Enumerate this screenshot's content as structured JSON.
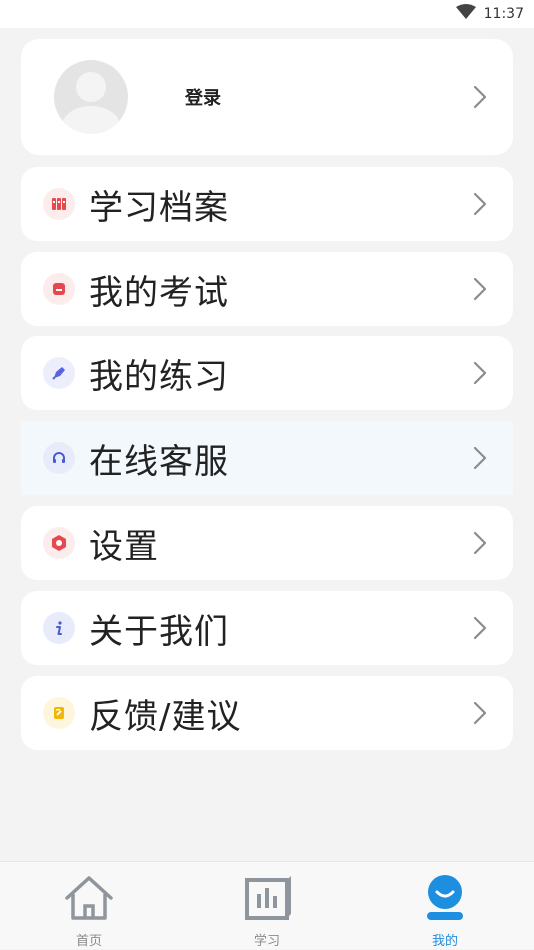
{
  "status_bar": {
    "time": "11:37"
  },
  "profile": {
    "login_label": "登录"
  },
  "menu": [
    {
      "label": "学习档案",
      "icon": "archive-icon"
    },
    {
      "label": "我的考试",
      "icon": "exam-icon"
    },
    {
      "label": "我的练习",
      "icon": "practice-icon"
    },
    {
      "label": "在线客服",
      "icon": "headset-icon"
    },
    {
      "label": "设置",
      "icon": "settings-icon"
    },
    {
      "label": "关于我们",
      "icon": "info-icon"
    },
    {
      "label": "反馈/建议",
      "icon": "feedback-icon"
    }
  ],
  "tabs": [
    {
      "label": "首页",
      "icon": "home-icon"
    },
    {
      "label": "学习",
      "icon": "study-icon"
    },
    {
      "label": "我的",
      "icon": "profile-icon",
      "active": true
    }
  ],
  "colors": {
    "accent": "#1e8fe0",
    "background": "#f3f3f3",
    "card": "#ffffff"
  }
}
